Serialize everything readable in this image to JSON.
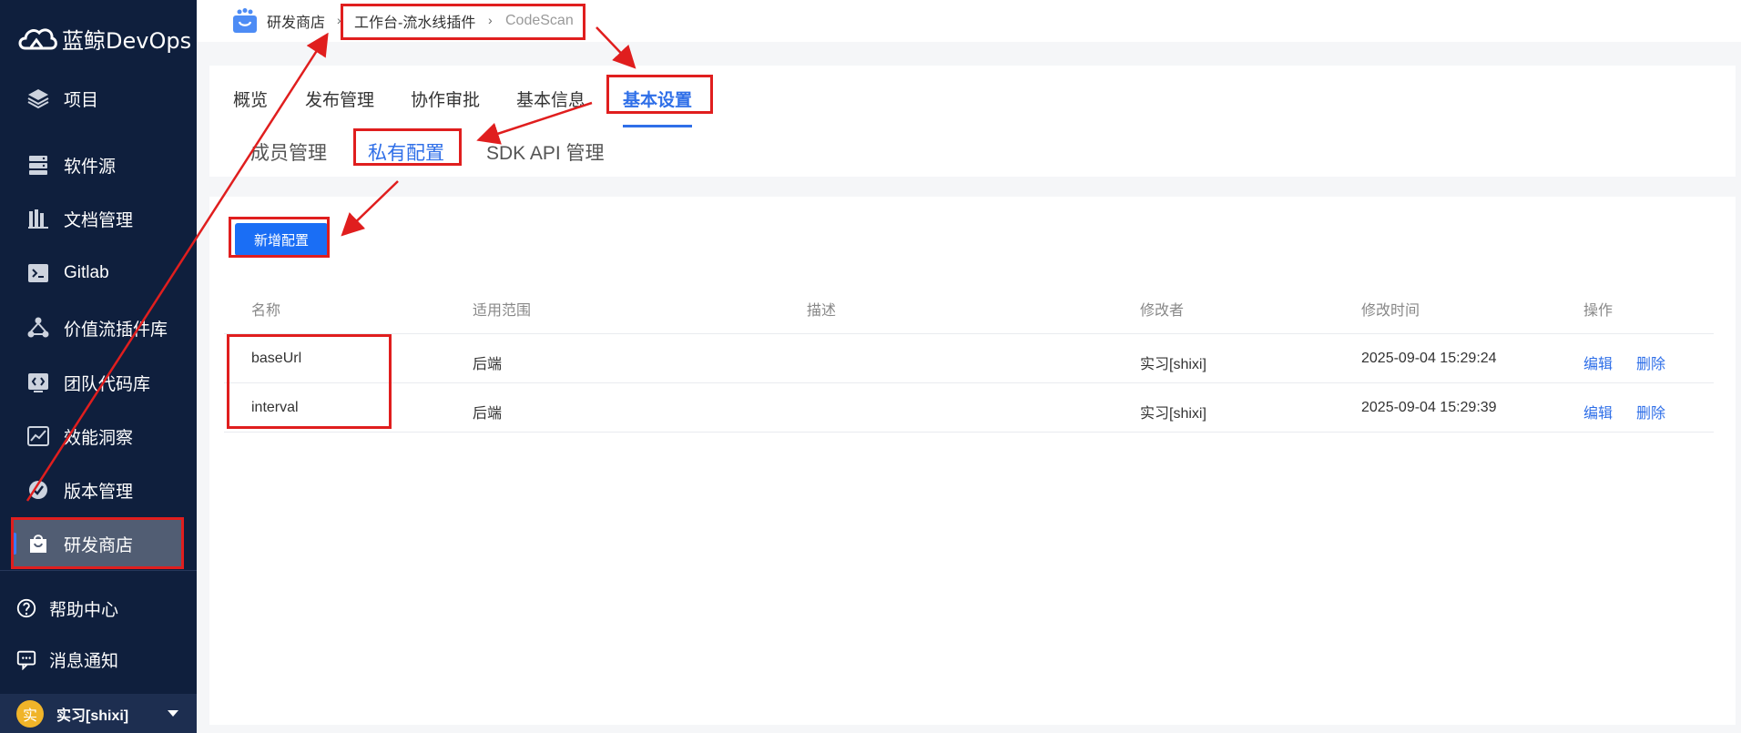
{
  "brand": {
    "name": "蓝鲸DevOps"
  },
  "sidebar": {
    "items": [
      {
        "label": "项目",
        "icon": "layers-icon"
      },
      {
        "label": "软件源",
        "icon": "server-icon"
      },
      {
        "label": "文档管理",
        "icon": "document-icon"
      },
      {
        "label": "Gitlab",
        "icon": "terminal-icon"
      },
      {
        "label": "价值流插件库",
        "icon": "plugin-network-icon"
      },
      {
        "label": "团队代码库",
        "icon": "code-icon"
      },
      {
        "label": "效能洞察",
        "icon": "chart-line-icon"
      },
      {
        "label": "版本管理",
        "icon": "version-icon"
      },
      {
        "label": "研发商店",
        "icon": "store-bag-icon",
        "active": true
      }
    ],
    "bottom": [
      {
        "label": "帮助中心",
        "icon": "help-icon"
      },
      {
        "label": "消息通知",
        "icon": "message-icon"
      }
    ],
    "user": {
      "avatar_char": "实",
      "name": "实习[shixi]"
    }
  },
  "breadcrumb": {
    "items": [
      "研发商店",
      "工作台-流水线插件",
      "CodeScan"
    ]
  },
  "tabs": {
    "primary": [
      "概览",
      "发布管理",
      "协作审批",
      "基本信息",
      "基本设置"
    ],
    "active_primary": "基本设置",
    "secondary": [
      "成员管理",
      "私有配置",
      "SDK API 管理"
    ],
    "active_secondary": "私有配置"
  },
  "actions": {
    "add_label": "新增配置"
  },
  "table": {
    "columns": [
      "名称",
      "适用范围",
      "描述",
      "修改者",
      "修改时间",
      "操作"
    ],
    "rows": [
      {
        "name": "baseUrl",
        "scope": "后端",
        "desc": "",
        "modifier": "实习[shixi]",
        "time": "2025-09-04 15:29:24",
        "edit": "编辑",
        "delete": "删除"
      },
      {
        "name": "interval",
        "scope": "后端",
        "desc": "",
        "modifier": "实习[shixi]",
        "time": "2025-09-04 15:29:39",
        "edit": "编辑",
        "delete": "删除"
      }
    ]
  },
  "colors": {
    "sidebar_bg": "#0f1f3d",
    "accent": "#2f6fe8",
    "annotation": "#e01e1e"
  }
}
